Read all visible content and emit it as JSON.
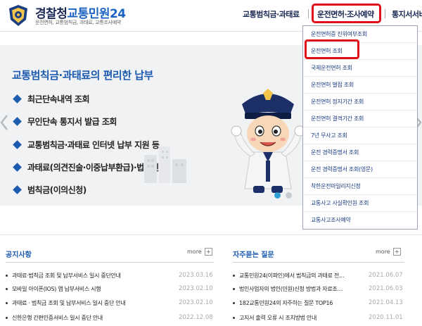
{
  "header": {
    "brand_main": "경찰청",
    "brand_accent": "교통민원24",
    "subtitle": "운전면허, 교통범칙금, 과태료, 교통조사예약",
    "nav": [
      "교통범칙금·과태료",
      "운전면허·조사예약",
      "통지서서비스"
    ]
  },
  "banner": {
    "title": "교통범칙금·과태료의 편리한 납부",
    "items": [
      "최근단속내역 조회",
      "무인단속 통지서 발급 조회",
      "교통범칙금·과태료 인터넷 납부 지원 등",
      "과태료(의견진술·이중납부환급)·법인신청",
      "범칙금(이의신청)"
    ],
    "colors": {
      "accent": "#1c5bb0",
      "background": "#f1f2f4",
      "highlight": "#e0101a"
    }
  },
  "dropdown": {
    "items": [
      "운전면허증 진위여부조회",
      "운전면허 조회",
      "국제운전면허 조회",
      "운전면허 벌점 조회",
      "운전면허 정지기간 조회",
      "운전면허 결격기간 조회",
      "7년 무사고 조회",
      "운전 경력증명서 조회",
      "운전 경력증명서 조회(영문)",
      "착한운전마일리지신청",
      "교통사고 사실확인원 조회",
      "교통사고조사예약"
    ]
  },
  "notice": {
    "title": "공지사항",
    "more": "more",
    "posts": [
      {
        "title": "과태료·범칙금 조회 및 납부서비스 일시 중단안내",
        "date": "2023.03.16"
      },
      {
        "title": "모바일 아이폰(IOS) 앱 납부서비스 시행",
        "date": "2023.02.10"
      },
      {
        "title": "과태료 · 범칙금 조회 및 납부서비스 일시 중단 안내",
        "date": "2023.02.10"
      },
      {
        "title": "신한은행 간편인증서비스 일시 중단 안내",
        "date": "2022.12.08"
      }
    ]
  },
  "faq": {
    "title": "자주묻는 질문",
    "more": "more",
    "posts": [
      {
        "title": "교통민원24(이파인)에서 범칙금의 과태료 전…",
        "date": "2021.06.07"
      },
      {
        "title": "법인사업자의 법인(민원)신청 방법과 자료조…",
        "date": "2021.06.03"
      },
      {
        "title": "182교통민원24의 자주하는 질문 TOP16",
        "date": "2021.04.13"
      },
      {
        "title": "고지서 출력 오류 시 조치방법 안내",
        "date": "2020.11.01"
      }
    ]
  }
}
